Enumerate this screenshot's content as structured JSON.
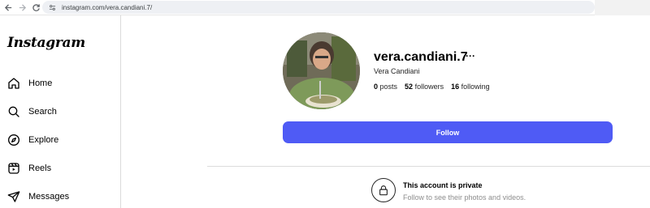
{
  "browser": {
    "url": "instagram.com/vera.candiani.7/"
  },
  "sidebar": {
    "logo": "Instagram",
    "items": [
      {
        "label": "Home",
        "icon": "home-icon"
      },
      {
        "label": "Search",
        "icon": "search-icon"
      },
      {
        "label": "Explore",
        "icon": "compass-icon"
      },
      {
        "label": "Reels",
        "icon": "reels-icon"
      },
      {
        "label": "Messages",
        "icon": "send-icon"
      }
    ]
  },
  "profile": {
    "username": "vera.candiani.7",
    "more": "···",
    "full_name": "Vera Candiani",
    "posts_count": "0",
    "posts_label": "posts",
    "followers_count": "52",
    "followers_label": "followers",
    "following_count": "16",
    "following_label": "following",
    "follow_label": "Follow"
  },
  "private": {
    "title": "This account is private",
    "subtitle": "Follow to see their photos and videos."
  },
  "colors": {
    "follow_button": "#4f5bf5",
    "border": "#dbdbdb"
  }
}
